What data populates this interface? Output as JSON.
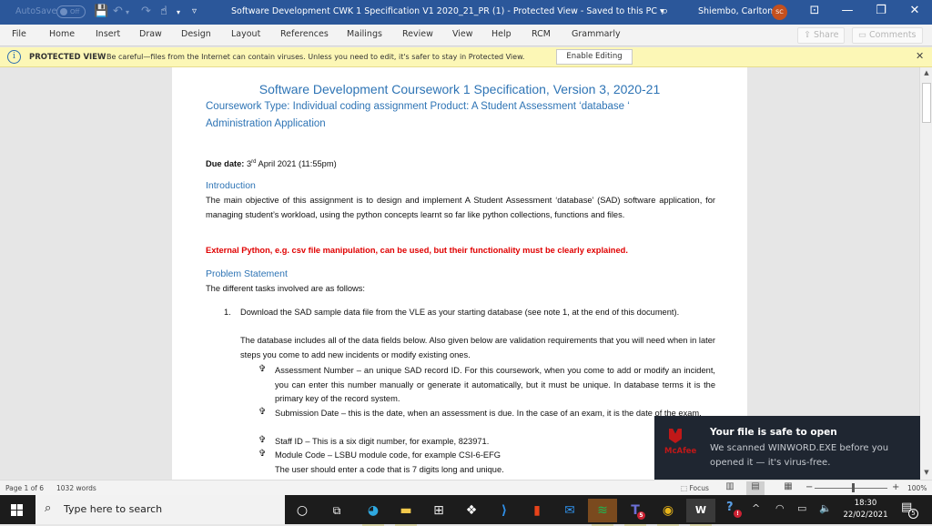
{
  "titlebar": {
    "autosave_label": "AutoSave",
    "autosave_state": "Off",
    "document_title": "Software Development CWK 1 Specification V1 2020_21_PR (1)  -  Protected View  -  Saved to this PC",
    "user_name": "Shiembo, Carlton",
    "user_initials": "SC",
    "icons": {
      "save": "💾",
      "undo": "↶",
      "redo": "↷",
      "touch": "☝",
      "customize": "▿",
      "search": "⌕",
      "ribbon_display": "⊡",
      "minimize": "—",
      "restore": "❐",
      "close": "✕",
      "dropdown": "▾"
    }
  },
  "ribbon": {
    "tabs": [
      "File",
      "Home",
      "Insert",
      "Draw",
      "Design",
      "Layout",
      "References",
      "Mailings",
      "Review",
      "View",
      "Help",
      "RCM",
      "Grammarly"
    ],
    "share_label": "Share",
    "comments_label": "Comments",
    "share_icon": "⇪",
    "comments_icon": "▭"
  },
  "protected_view": {
    "label": "PROTECTED VIEW",
    "message": "Be careful—files from the Internet can contain viruses. Unless you need to edit, it's safer to stay in Protected View.",
    "enable_button": "Enable Editing",
    "info_icon": "i",
    "close_icon": "✕"
  },
  "document": {
    "title": "Software Development Coursework 1 Specification, Version 3, 2020-21",
    "subtitle_line1": "Coursework Type: Individual coding assignment Product: A Student Assessment ‘database ‘",
    "subtitle_line2": "Administration Application",
    "due_label": "Due date:",
    "due_value_prefix": " 3",
    "due_value_sup": "rd",
    "due_value_suffix": " April 2021 (11:55pm)",
    "intro_heading": "Introduction",
    "intro_text": "The main objective of this assignment is to design and implement A Student Assessment ‘database’ (SAD) software application, for managing student’s workload, using the python concepts learnt so far like python collections, functions and files.",
    "red_note": "External Python, e.g. csv file manipulation, can be used, but their functionality must be clearly explained.",
    "problem_heading": "Problem Statement",
    "problem_text": "The different tasks involved are as follows:",
    "list_item_1_number": "1.",
    "list_item_1_text": "Download the SAD sample data file from the VLE as your starting database (see note 1, at the end of this document).",
    "list_item_1_para": "The database includes all of the data fields below. Also given below are validation requirements that you will need when in later steps you come to add new incidents or modify existing ones.",
    "bullet_glyph": "✞",
    "bullets": [
      "Assessment Number – an unique SAD record ID. For this coursework, when you come to add or modify an incident, you can enter this number manually or generate it automatically, but it must be unique. In database terms it is the primary key of the record system.",
      "Submission Date – this is the date, when an assessment is due. In the case of an exam, it is the date of the exam.",
      "Staff ID – This is a six digit number, for example, 823971.",
      "Module Code – LSBU module code, for example CSI-6-EFG"
    ],
    "trailing_text": "The user should enter a code that is 7 digits long and unique."
  },
  "statusbar": {
    "page": "Page 1 of 6",
    "words": "1032 words",
    "focus_label": "Focus",
    "zoom_minus": "−",
    "zoom_plus": "+",
    "zoom_level": "100%",
    "zoom_percent": 100
  },
  "toast": {
    "brand": "McAfee",
    "title": "Your file is safe to open",
    "body": "We scanned WINWORD.EXE before you opened it — it's virus-free."
  },
  "taskbar": {
    "search_placeholder": "Type here to search",
    "time": "18:30",
    "date": "22/02/2021",
    "notification_count": "5",
    "teams_badge": "5",
    "help_badge": "!",
    "apps": [
      {
        "name": "cortana",
        "glyph": "○"
      },
      {
        "name": "task-view",
        "glyph": "⧉"
      },
      {
        "name": "edge",
        "glyph": "◕"
      },
      {
        "name": "file-explorer",
        "glyph": "▬"
      },
      {
        "name": "store",
        "glyph": "⊞"
      },
      {
        "name": "dropbox",
        "glyph": "❖"
      },
      {
        "name": "power-automate",
        "glyph": "⟩"
      },
      {
        "name": "office",
        "glyph": "▮"
      },
      {
        "name": "mail",
        "glyph": "✉"
      },
      {
        "name": "spotify",
        "glyph": "≋"
      },
      {
        "name": "teams",
        "glyph": "T"
      },
      {
        "name": "chrome",
        "glyph": "◉"
      },
      {
        "name": "word",
        "glyph": "W"
      }
    ],
    "tray": {
      "help": "?",
      "chevron": "^",
      "wifi": "◠",
      "battery": "▭",
      "volume": "🔈"
    }
  },
  "colors": {
    "title_bar": "#2b579a",
    "heading_blue": "#2e74b5",
    "warning_red": "#e00000",
    "protected_bar": "#fcf7b6",
    "toast_bg": "#1f2631",
    "mcafee_red": "#c01818",
    "avatar": "#c4501e"
  }
}
